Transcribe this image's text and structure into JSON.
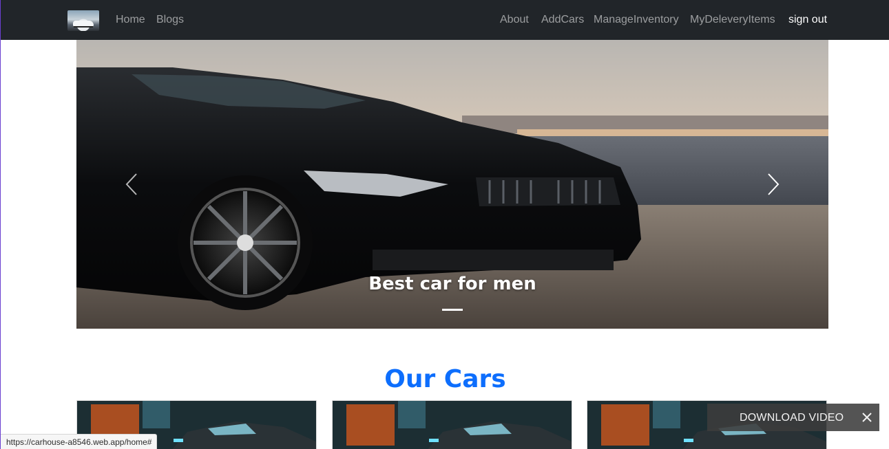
{
  "navbar": {
    "logo_icon": "car-thumbnail-icon",
    "left_links": [
      "Home",
      "Blogs"
    ],
    "right_links": [
      "About",
      "AddCars",
      "ManageInventory",
      "MyDeleveryItems",
      "sign out"
    ],
    "background": "#212529"
  },
  "carousel": {
    "caption": "Best car for men",
    "prev_icon": "chevron-left-icon",
    "next_icon": "chevron-right-icon"
  },
  "main": {
    "section_title": "Our Cars",
    "title_color": "#0d6efd"
  },
  "cards": [
    {
      "image_icon": "car-image-icon"
    },
    {
      "image_icon": "car-image-icon"
    },
    {
      "image_icon": "car-image-icon"
    }
  ],
  "download_overlay": {
    "label": "DOWNLOAD VIDEO",
    "close_icon": "close-icon"
  },
  "status_bar": {
    "url": "https://carhouse-a8546.web.app/home#"
  }
}
